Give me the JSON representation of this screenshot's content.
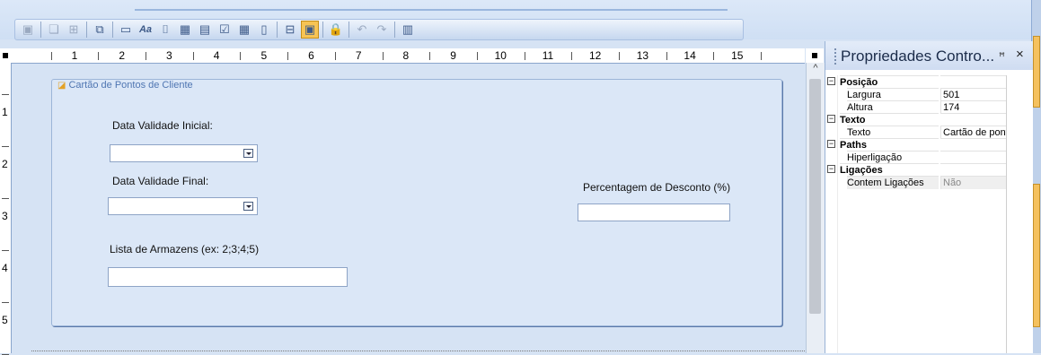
{
  "toolbar": {
    "buttons": [
      {
        "name": "save-icon",
        "glyph": "▣",
        "state": "disabled"
      },
      {
        "sep": true
      },
      {
        "name": "properties-icon",
        "glyph": "❏",
        "state": "disabled"
      },
      {
        "name": "select-all-icon",
        "glyph": "⊞",
        "state": "disabled"
      },
      {
        "sep": true
      },
      {
        "name": "tab-order-icon",
        "glyph": "⧉",
        "state": "normal"
      },
      {
        "sep": true
      },
      {
        "name": "label-icon",
        "glyph": "▭",
        "state": "normal"
      },
      {
        "name": "font-icon",
        "glyph": "Aa",
        "state": "normal"
      },
      {
        "name": "textbox-icon",
        "glyph": "⌷",
        "state": "normal"
      },
      {
        "name": "calendar-icon",
        "glyph": "▦",
        "state": "normal"
      },
      {
        "name": "grid-icon",
        "glyph": "▤",
        "state": "normal"
      },
      {
        "name": "checkbox-icon",
        "glyph": "☑",
        "state": "normal"
      },
      {
        "name": "table-icon",
        "glyph": "▦",
        "state": "normal"
      },
      {
        "name": "document-icon",
        "glyph": "▯",
        "state": "normal"
      },
      {
        "sep": true
      },
      {
        "name": "tab-control-icon",
        "glyph": "⊟",
        "state": "normal"
      },
      {
        "name": "highlight-icon",
        "glyph": "▣",
        "state": "active"
      },
      {
        "sep": true
      },
      {
        "name": "lock-icon",
        "glyph": "🔒",
        "state": "normal"
      },
      {
        "sep": true
      },
      {
        "name": "undo-icon",
        "glyph": "↶",
        "state": "disabled"
      },
      {
        "name": "redo-icon",
        "glyph": "↷",
        "state": "disabled"
      },
      {
        "sep": true
      },
      {
        "name": "preview-icon",
        "glyph": "▥",
        "state": "normal"
      }
    ]
  },
  "ruler": {
    "horizontal": [
      "1",
      "2",
      "3",
      "4",
      "5",
      "6",
      "7",
      "8",
      "9",
      "10",
      "11",
      "12",
      "13",
      "14",
      "15"
    ],
    "vertical": [
      "1",
      "2",
      "3",
      "4",
      "5"
    ]
  },
  "form": {
    "group_title": "Cartão de Pontos de Cliente",
    "data_validade_inicial_label": "Data Validade Inicial:",
    "data_validade_final_label": "Data Validade Final:",
    "percentagem_label": "Percentagem de Desconto (%)",
    "lista_armazens_label": "Lista de Armazens (ex: 2;3;4;5)",
    "data_validade_inicial_value": "",
    "data_validade_final_value": "",
    "percentagem_value": "",
    "lista_armazens_value": ""
  },
  "properties": {
    "title": "Propriedades Contro...",
    "pin": "ᵖ",
    "close": "×",
    "rows": [
      {
        "type": "category",
        "name": "Posição"
      },
      {
        "type": "prop",
        "name": "Largura",
        "value": "501"
      },
      {
        "type": "prop",
        "name": "Altura",
        "value": "174"
      },
      {
        "type": "category",
        "name": "Texto"
      },
      {
        "type": "prop",
        "name": "Texto",
        "value": "Cartão de pontos"
      },
      {
        "type": "category",
        "name": "Paths"
      },
      {
        "type": "prop",
        "name": "Hiperligação",
        "value": ""
      },
      {
        "type": "category",
        "name": "Ligações"
      },
      {
        "type": "prop",
        "name": "Contem Ligações",
        "value": "Não",
        "readonly": true
      }
    ]
  }
}
